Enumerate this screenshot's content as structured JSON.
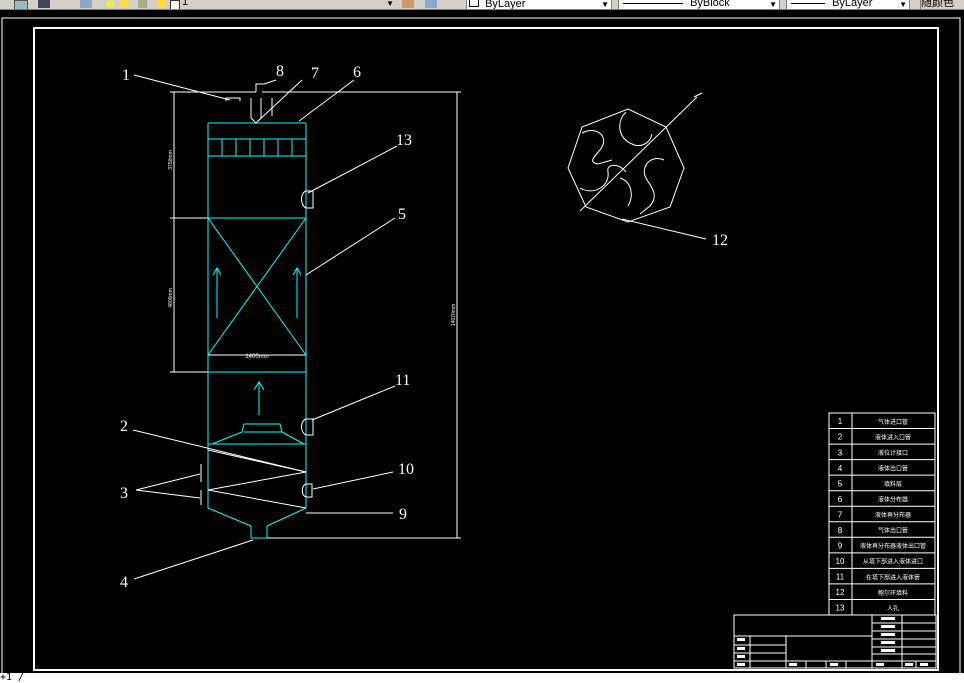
{
  "toolbar": {
    "layer_value": "1",
    "color_value": "ByLayer",
    "linetype_value": "ByBlock",
    "lineweight_value": "ByLayer",
    "plot_style_value": "随颜色"
  },
  "callouts": [
    "1",
    "2",
    "3",
    "4",
    "5",
    "6",
    "7",
    "8",
    "9",
    "10",
    "11",
    "12",
    "13"
  ],
  "dims": {
    "upper": "3750mm",
    "packing": "4800mm",
    "total": "14070mm",
    "width": "1400mm"
  },
  "legend": [
    {
      "no": "1",
      "text": "气体进口管"
    },
    {
      "no": "2",
      "text": "液体进入口管"
    },
    {
      "no": "3",
      "text": "液位计接口"
    },
    {
      "no": "4",
      "text": "液体出口管"
    },
    {
      "no": "5",
      "text": "填料层"
    },
    {
      "no": "6",
      "text": "液体分布器"
    },
    {
      "no": "7",
      "text": "液体再分布器"
    },
    {
      "no": "8",
      "text": "气体出口管"
    },
    {
      "no": "9",
      "text": "液体再分布器液体出口管"
    },
    {
      "no": "10",
      "text": "从塔下部进入液体进口"
    },
    {
      "no": "11",
      "text": "在塔下部进入液体管"
    },
    {
      "no": "12",
      "text": "鲍尔环填料"
    },
    {
      "no": "13",
      "text": "人孔"
    }
  ],
  "command_line": "+1 /"
}
